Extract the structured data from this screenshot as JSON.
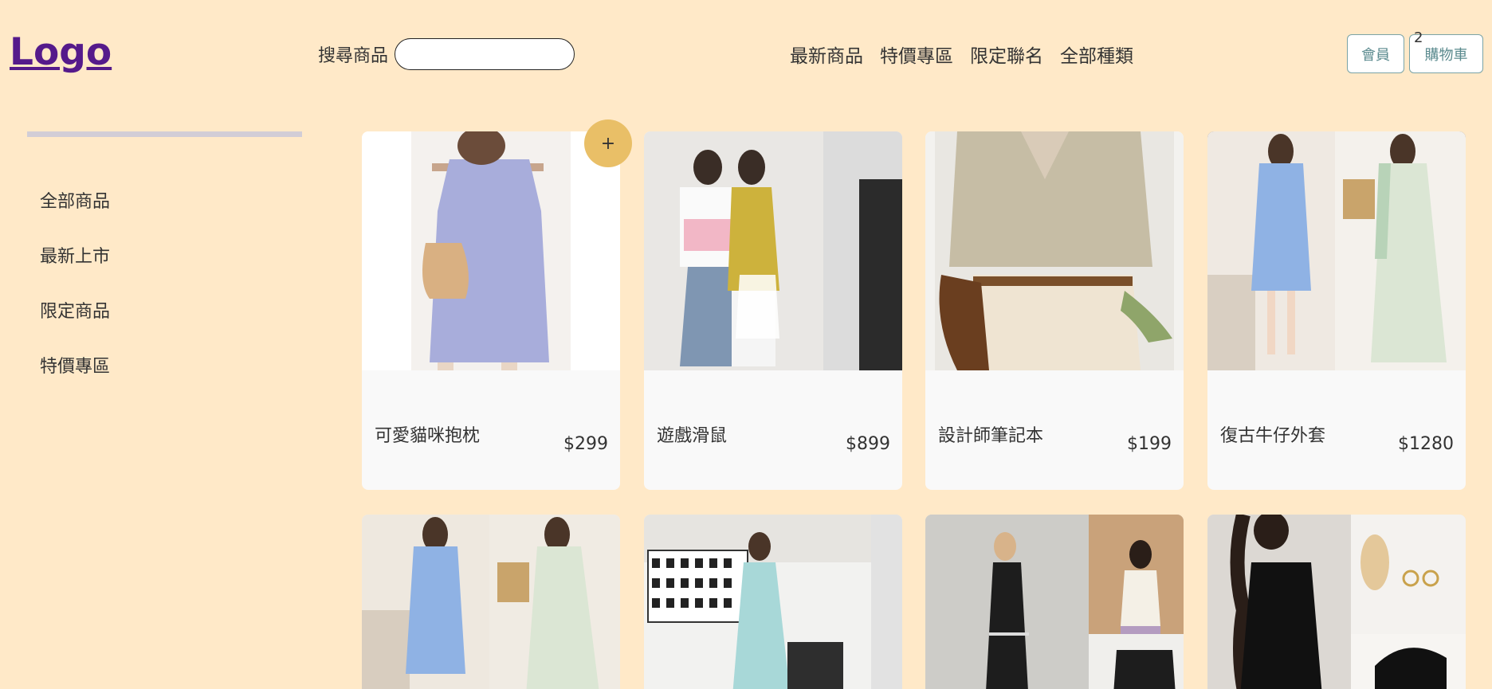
{
  "header": {
    "logo": "Logo",
    "search_label": "搜尋商品",
    "search_value": "",
    "search_placeholder": "",
    "nav": [
      "最新商品",
      "特價專區",
      "限定聯名",
      "全部種類"
    ],
    "member_label": "會員",
    "cart_label": "購物車",
    "cart_count": "2"
  },
  "sidebar": {
    "items": [
      "全部商品",
      "最新上市",
      "限定商品",
      "特價專區"
    ]
  },
  "products": [
    {
      "name": "可愛貓咪抱枕",
      "price": "$299"
    },
    {
      "name": "遊戲滑鼠",
      "price": "$899"
    },
    {
      "name": "設計師筆記本",
      "price": "$199"
    },
    {
      "name": "復古牛仔外套",
      "price": "$1280"
    }
  ],
  "add_button": "+",
  "colors": {
    "background": "#ffe9c8",
    "logo": "#551a8b",
    "accent": "#e9bf67",
    "button_border": "#7aa3a6"
  }
}
